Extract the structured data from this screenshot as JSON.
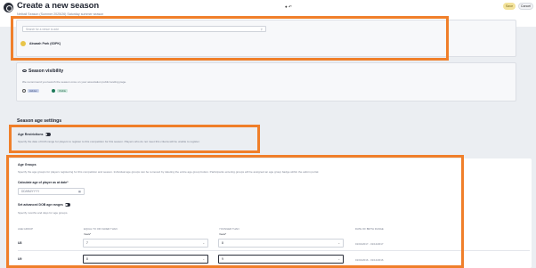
{
  "header": {
    "title": "Create a new season",
    "subtitle": "Netball Season (Summer 2025/26) Saturday summer season",
    "top_icons": "● ↶",
    "save_label": "Save",
    "cancel_label": "Cancel"
  },
  "venue": {
    "search_placeholder": "Search for a venue to add",
    "venue_name": "Akwaah Park (6DPK)"
  },
  "visibility": {
    "title": "Season visibility",
    "description": "We recommend you launch the season once on your association public landing page.",
    "option_a": "Hidden",
    "option_b": "Visible"
  },
  "age_settings": {
    "heading": "Season age settings",
    "restrictions_label": "Age Restrictions",
    "restrictions_desc": "Specify the date of birth range for players to register to this competition for this season. Players who do not meet this criteria will be unable to register."
  },
  "age_groups": {
    "title": "Age Groups",
    "description": "Specify the age groups for players registering for this competition and season. Individual age groups can be removed by deleting the entire age group button. Participants entering groups will be assigned an age group badge within the admin portal.",
    "calc_label": "Calculate age of player as at date*",
    "date_placeholder": "DD/MM/YYYY",
    "advanced_label": "Set advanced DOB age ranges",
    "advanced_desc": "Specify months and days for age groups.",
    "columns": {
      "age_group": "Age group",
      "equal_older": "Equal to or older than",
      "younger": "Younger than",
      "dob_range": "Date of birth range",
      "years": "Years*"
    },
    "rows": [
      {
        "label": "U8",
        "from": "7",
        "to": "8",
        "dob": "01/01/2017 - 31/12/2017"
      },
      {
        "label": "U9",
        "from": "8",
        "to": "9",
        "dob": "01/01/2016 - 31/12/2016"
      }
    ]
  },
  "colors": {
    "highlight": "#f07f2a",
    "save_bg": "#f3e39c"
  }
}
